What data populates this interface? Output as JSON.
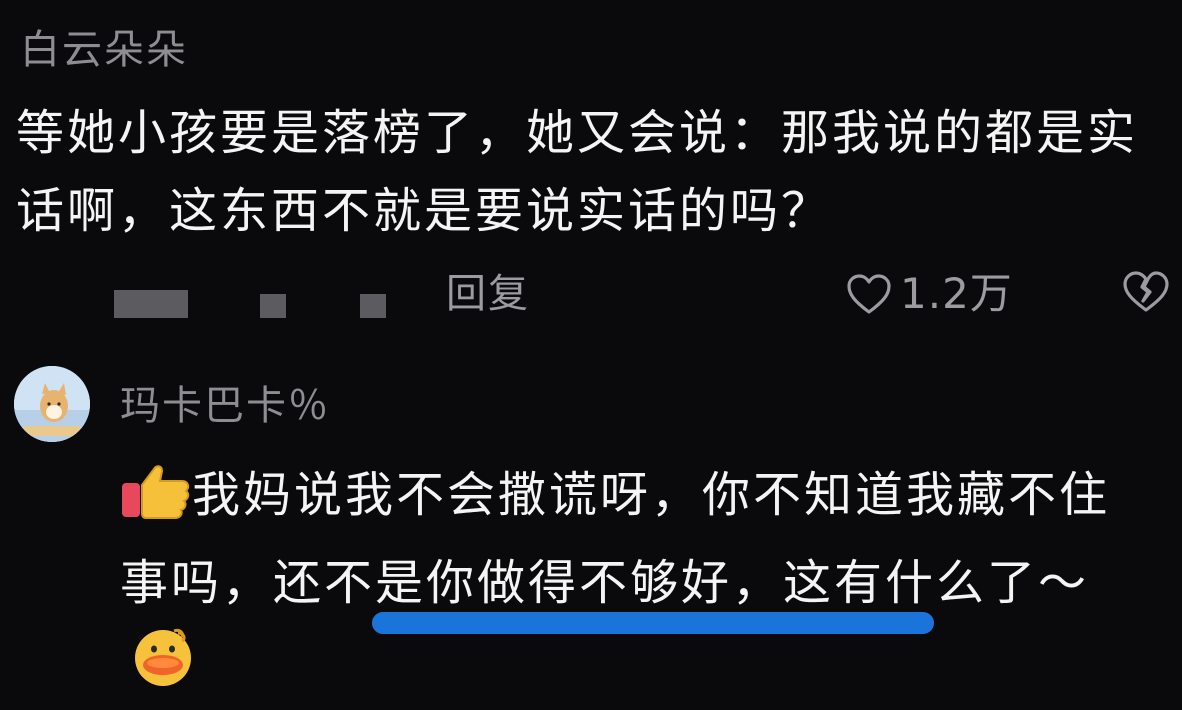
{
  "comment1": {
    "username": "白云朵朵",
    "text": "等她小孩要是落榜了，她又会说：那我说的都是实话啊，这东西不就是要说实话的吗？",
    "reply_label": "回复",
    "like_count": "1.2万",
    "icons": {
      "like": "heart-outline-icon",
      "dislike": "broken-heart-icon"
    }
  },
  "comment2": {
    "username": "玛卡巴卡％",
    "text": "我妈说我不会撒谎呀，你不知道我藏不住事吗，还不是你做得不够好，这有什么了～",
    "icons": {
      "leading": "thumbs-up-emoji-icon",
      "trailing": "duck-emoji-icon"
    }
  },
  "colors": {
    "background": "#0a0a0c",
    "text": "#f4f4f4",
    "muted": "#8d8d92",
    "highlight": "#1a74d9"
  }
}
